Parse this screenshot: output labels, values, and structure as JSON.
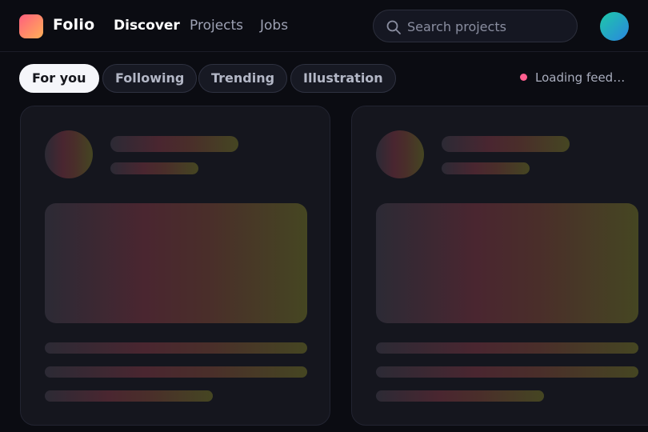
{
  "app": {
    "name": "Folio"
  },
  "nav": {
    "items": [
      {
        "label": "Discover",
        "active": true
      },
      {
        "label": "Projects",
        "active": false
      },
      {
        "label": "Jobs",
        "active": false
      }
    ]
  },
  "search": {
    "placeholder": "Search projects",
    "value": ""
  },
  "filters": {
    "chips": [
      {
        "label": "For you",
        "active": true
      },
      {
        "label": "Following",
        "active": false
      },
      {
        "label": "Trending",
        "active": false
      },
      {
        "label": "Illustration",
        "active": false
      }
    ]
  },
  "status": {
    "text": "Loading feed…",
    "dot_color": "#ff5f8f"
  },
  "colors": {
    "background": "#0b0c12",
    "logo_gradient": [
      "#ff5f7e",
      "#ffb057"
    ],
    "avatar_gradient": [
      "#1ec9a8",
      "#2a86e0"
    ],
    "skeleton_gradient": [
      "#2c2a35",
      "#4a2630",
      "#454622"
    ]
  },
  "icons": {
    "search": "search-icon"
  }
}
